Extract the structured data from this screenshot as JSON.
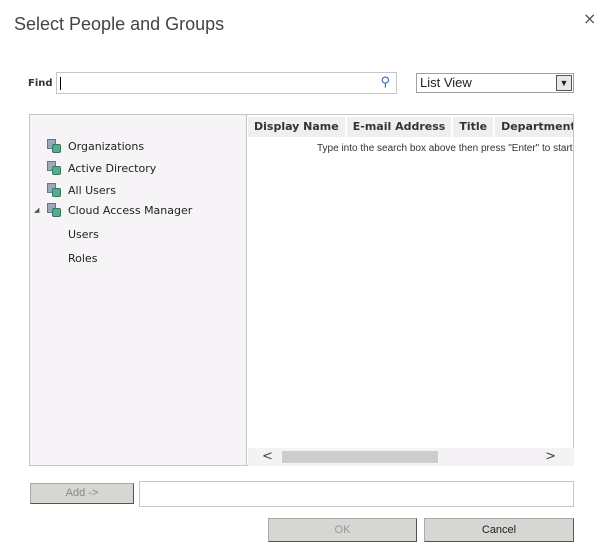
{
  "dialog": {
    "title": "Select People and Groups",
    "close_icon": "×"
  },
  "find": {
    "label": "Find",
    "value": "",
    "search_icon": "⚲"
  },
  "view": {
    "selected": "List View",
    "arrow": "⌄"
  },
  "tree": {
    "nodes": [
      "Organizations",
      "Active Directory",
      "All Users",
      "Cloud Access Manager"
    ],
    "children": [
      "Users",
      "Roles"
    ],
    "expand_icon": "◢"
  },
  "grid": {
    "columns": [
      "Display Name",
      "E-mail Address",
      "Title",
      "Department"
    ],
    "message": "Type into the search box above then press \"Enter\" to start your search"
  },
  "scroll": {
    "left": "<",
    "right": ">"
  },
  "buttons": {
    "add": "Add ->",
    "ok": "OK",
    "cancel": "Cancel"
  }
}
